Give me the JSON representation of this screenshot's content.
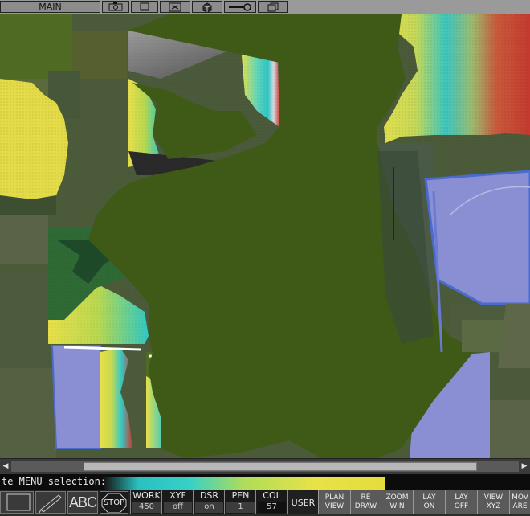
{
  "top_toolbar": {
    "menu_label": "MAIN",
    "icons": [
      "camera-icon",
      "page-icon",
      "transform-icon",
      "cube-icon",
      "key-icon",
      "layers-icon"
    ]
  },
  "command_line": {
    "text": "te MENU selection:"
  },
  "bottom_toolbar": {
    "tools": [
      "select-box-icon",
      "pencil-icon",
      "text-tool-icon",
      "stop-icon"
    ],
    "text_tool_label": "ABC",
    "stop_label": "STOP",
    "status": [
      {
        "label": "WORK",
        "value": "450"
      },
      {
        "label": "XYF",
        "value": "off"
      },
      {
        "label": "DSR",
        "value": "on"
      },
      {
        "label": "PEN",
        "value": "1"
      },
      {
        "label": "COL",
        "value": "57"
      }
    ],
    "user_label": "USER",
    "commands": [
      {
        "line1": "PLAN",
        "line2": "VIEW"
      },
      {
        "line1": "RE",
        "line2": "DRAW"
      },
      {
        "line1": "ZOOM",
        "line2": "WIN"
      },
      {
        "line1": "LAY",
        "line2": "ON"
      },
      {
        "line1": "LAY",
        "line2": "OFF"
      },
      {
        "line1": "VIEW",
        "line2": "XYZ"
      },
      {
        "line1": "MOV",
        "line2": "ARE"
      }
    ]
  },
  "colors": {
    "terrain": "#3f5a17",
    "yellow": "#e8e04a",
    "cyan": "#33d0c8",
    "red": "#c83a30",
    "lavender": "#8b8fd0"
  }
}
